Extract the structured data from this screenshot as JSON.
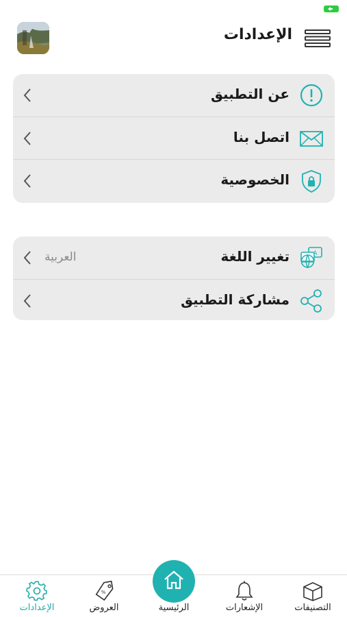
{
  "header": {
    "title": "الإعدادات"
  },
  "settings_group_1": [
    {
      "label": "عن التطبيق",
      "icon": "info-icon"
    },
    {
      "label": "اتصل بنا",
      "icon": "envelope-icon"
    },
    {
      "label": "الخصوصية",
      "icon": "shield-lock-icon"
    }
  ],
  "settings_group_2": [
    {
      "label": "تغيير اللغة",
      "icon": "language-icon",
      "value": "العربية"
    },
    {
      "label": "مشاركة التطبيق",
      "icon": "share-icon"
    }
  ],
  "bottom_nav": [
    {
      "label": "التصنيفات",
      "icon": "box-icon"
    },
    {
      "label": "الإشعارات",
      "icon": "bell-icon"
    },
    {
      "label": "الرئيسية",
      "icon": "home-icon"
    },
    {
      "label": "العروض",
      "icon": "tag-icon"
    },
    {
      "label": "الإعدادات",
      "icon": "gear-icon",
      "active": true
    }
  ],
  "colors": {
    "accent": "#20b2b0",
    "card_bg": "#ebebeb",
    "battery": "#2ecc40"
  }
}
